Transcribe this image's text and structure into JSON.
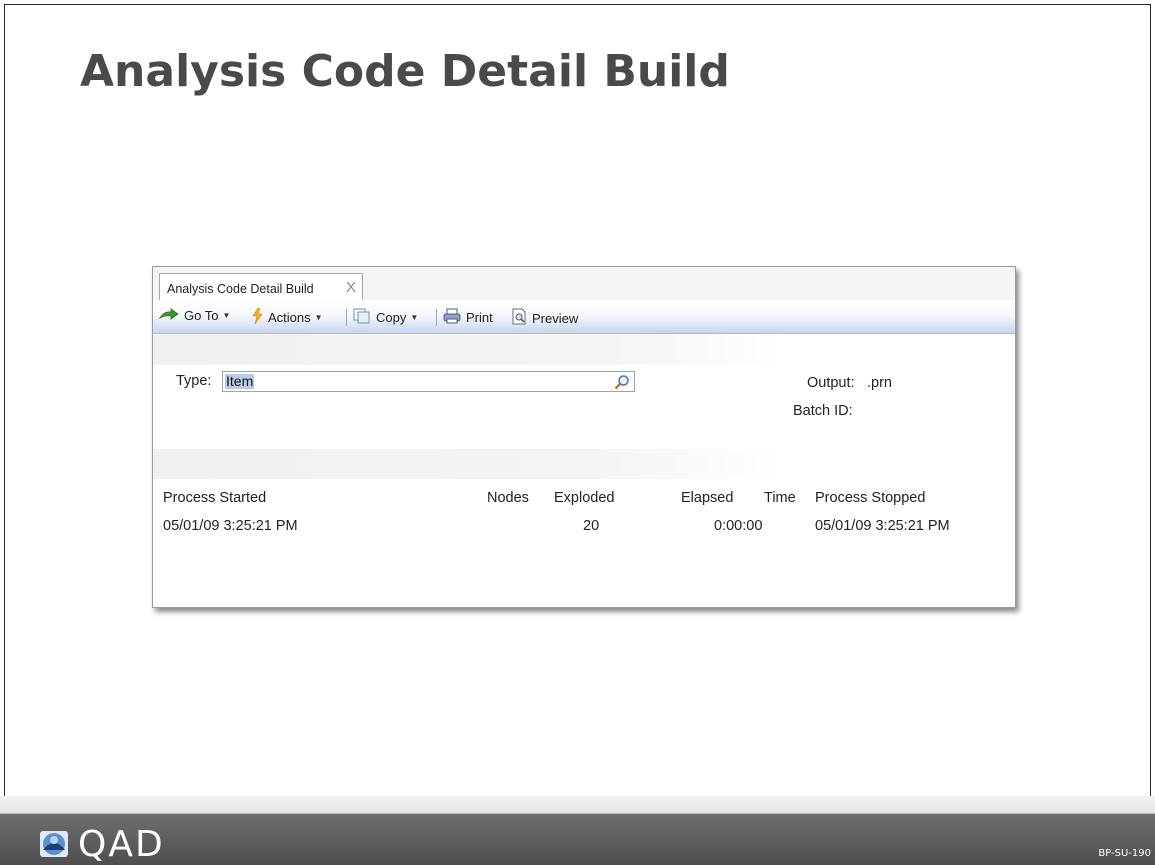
{
  "slide": {
    "title": "Analysis Code Detail Build",
    "slide_id": "BP-SU-190",
    "logo_text": "QAD"
  },
  "window": {
    "tab_label": "Analysis Code Detail Build",
    "tab_close": "X",
    "toolbar": {
      "goto_label": "Go To",
      "actions_label": "Actions",
      "copy_label": "Copy",
      "print_label": "Print",
      "preview_label": "Preview"
    },
    "form": {
      "type_label": "Type:",
      "type_value": "Item",
      "output_label": "Output:",
      "output_value": ".prn",
      "batch_label": "Batch ID:"
    },
    "results": {
      "headers": [
        "Process Started",
        "Nodes",
        "Exploded",
        "Elapsed",
        "Time",
        "Process Stopped"
      ],
      "row": {
        "process_started": "05/01/09  3:25:21 PM",
        "nodes_exploded": "20",
        "elapsed_time": "0:00:00",
        "process_stopped": "05/01/09  3:25:21 PM"
      }
    }
  },
  "colors": {
    "title": "#4a4a4a",
    "toolbar_gradient_end": "#c9d5ee",
    "footer": "#4f4f4f"
  }
}
